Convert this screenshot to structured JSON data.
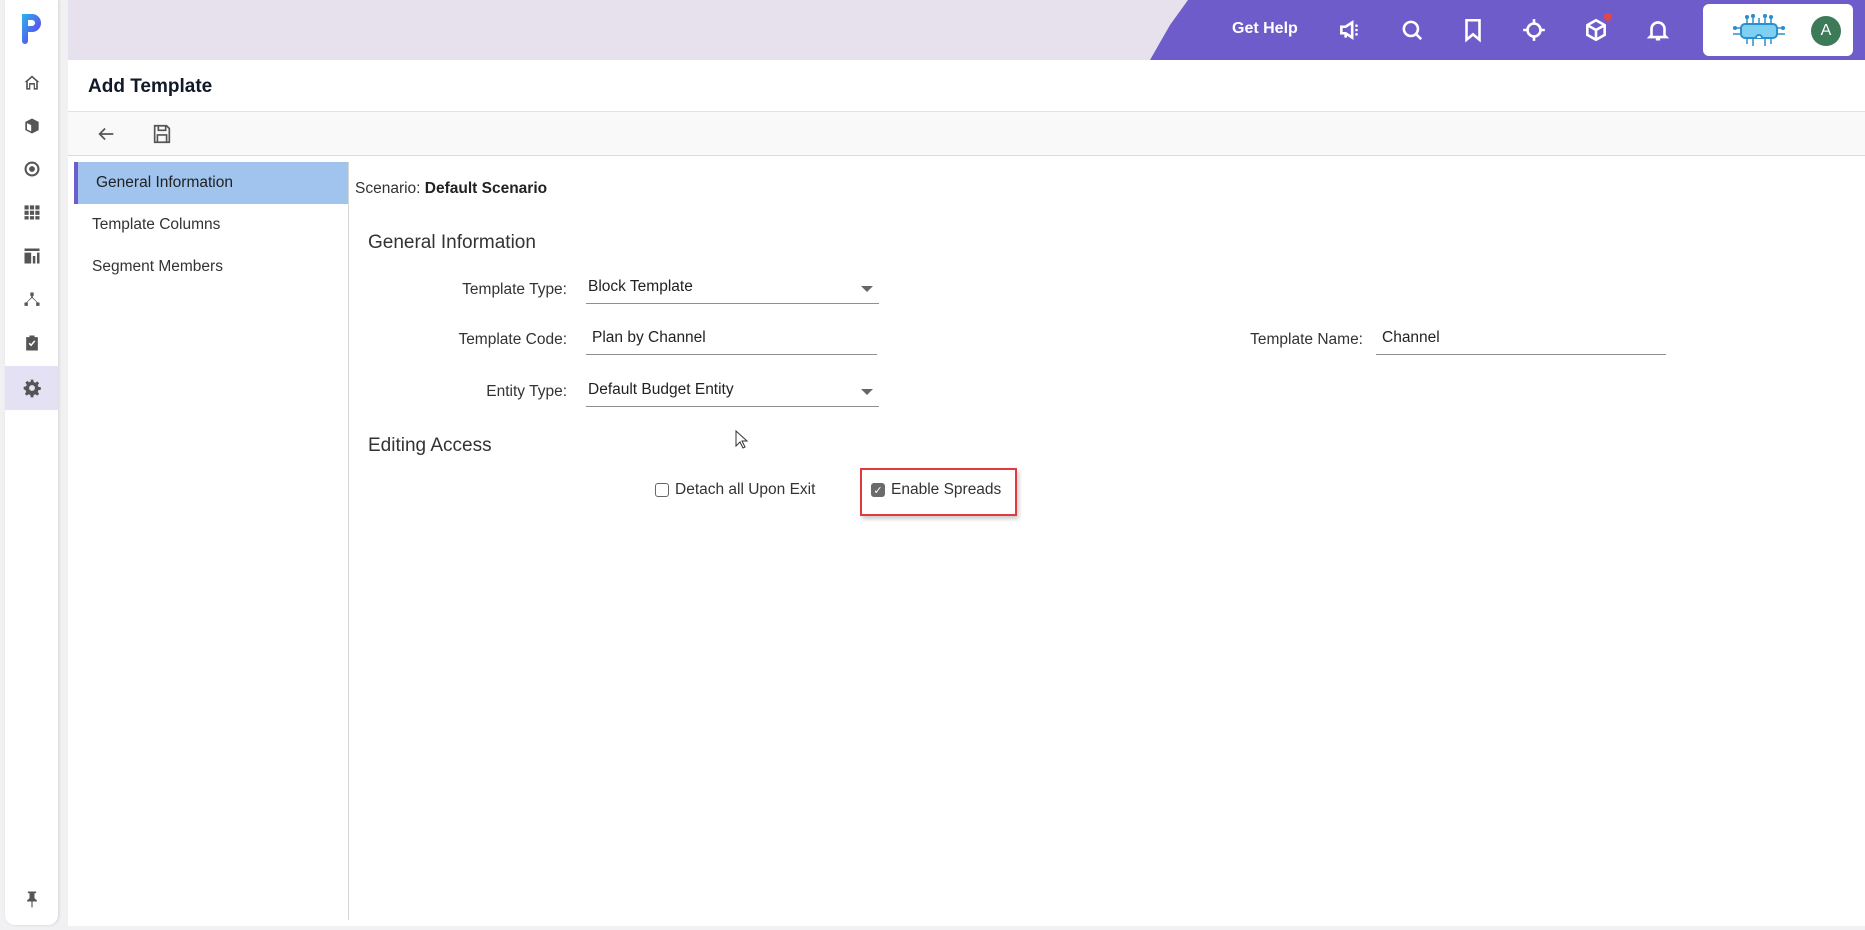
{
  "rail": {
    "items": [
      {
        "name": "home",
        "icon": "home-icon"
      },
      {
        "name": "models",
        "icon": "cube-icon"
      },
      {
        "name": "targets",
        "icon": "target-circle-icon"
      },
      {
        "name": "grid",
        "icon": "grid-icon"
      },
      {
        "name": "reports",
        "icon": "report-chart-icon"
      },
      {
        "name": "hierarchy",
        "icon": "hierarchy-icon"
      },
      {
        "name": "tasks",
        "icon": "clipboard-check-icon"
      },
      {
        "name": "settings",
        "icon": "gear-icon",
        "active": true
      }
    ],
    "pin_icon": "pin-icon"
  },
  "header": {
    "get_help": "Get Help",
    "icons": [
      "megaphone-icon",
      "search-icon",
      "bookmark-icon",
      "crosshair-icon",
      "cube-icon",
      "bell-icon"
    ],
    "notification_dot_color": "#e0474c",
    "avatar_initial": "A",
    "accent_color": "#6e5ccb"
  },
  "page": {
    "title": "Add Template",
    "toolbar": {
      "back_icon": "arrow-left-icon",
      "save_icon": "save-icon"
    }
  },
  "leftnav": {
    "items": [
      {
        "label": "General Information",
        "active": true
      },
      {
        "label": "Template Columns"
      },
      {
        "label": "Segment Members"
      }
    ]
  },
  "form": {
    "scenario_label": "Scenario:",
    "scenario_value": "Default Scenario",
    "general_section": "General Information",
    "template_type_label": "Template Type:",
    "template_type_value": "Block Template",
    "template_code_label": "Template Code:",
    "template_code_value": "Plan by Channel",
    "template_name_label": "Template Name:",
    "template_name_value": "Channel",
    "entity_type_label": "Entity Type:",
    "entity_type_value": "Default Budget Entity",
    "editing_section": "Editing Access",
    "detach_label": "Detach all Upon Exit",
    "detach_checked": false,
    "spreads_label": "Enable Spreads",
    "spreads_checked": true
  }
}
